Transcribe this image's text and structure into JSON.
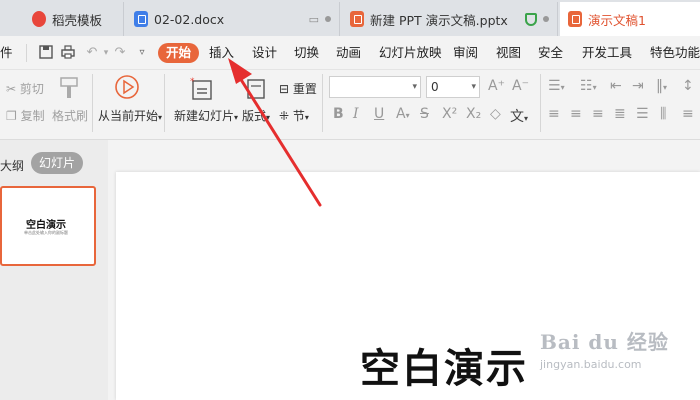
{
  "tabs": [
    {
      "label": "稻壳模板",
      "icon": "daoke-icon"
    },
    {
      "label": "02-02.docx",
      "icon": "word-doc-icon"
    },
    {
      "label": "新建 PPT 演示文稿.pptx",
      "icon": "ppt-icon"
    },
    {
      "label": "演示文稿1",
      "icon": "ppt-icon"
    }
  ],
  "menu": {
    "file_fragment": "件",
    "items": [
      "开始",
      "插入",
      "设计",
      "切换",
      "动画",
      "幻灯片放映",
      "审阅",
      "视图",
      "安全",
      "开发工具",
      "特色功能"
    ],
    "active": "开始"
  },
  "ribbon": {
    "cut": "剪切",
    "copy": "复制",
    "format_painter": "格式刷",
    "from_current": "从当前开始",
    "new_slide": "新建幻灯片",
    "layout": "版式",
    "reset": "重置",
    "section": "节",
    "font_size_value": "0",
    "font_name_value": ""
  },
  "left_panel": {
    "outline_tab": "大纲",
    "slides_tab": "幻灯片",
    "thumb_title": "空白演示",
    "thumb_sub": "单击此处输入你的副标题"
  },
  "slide": {
    "title": "空白演示"
  },
  "watermark": {
    "main": "Bai du 经验",
    "sub": "jingyan.baidu.com"
  },
  "colors": {
    "accent": "#e8663b",
    "arrow": "#e52e2e"
  }
}
